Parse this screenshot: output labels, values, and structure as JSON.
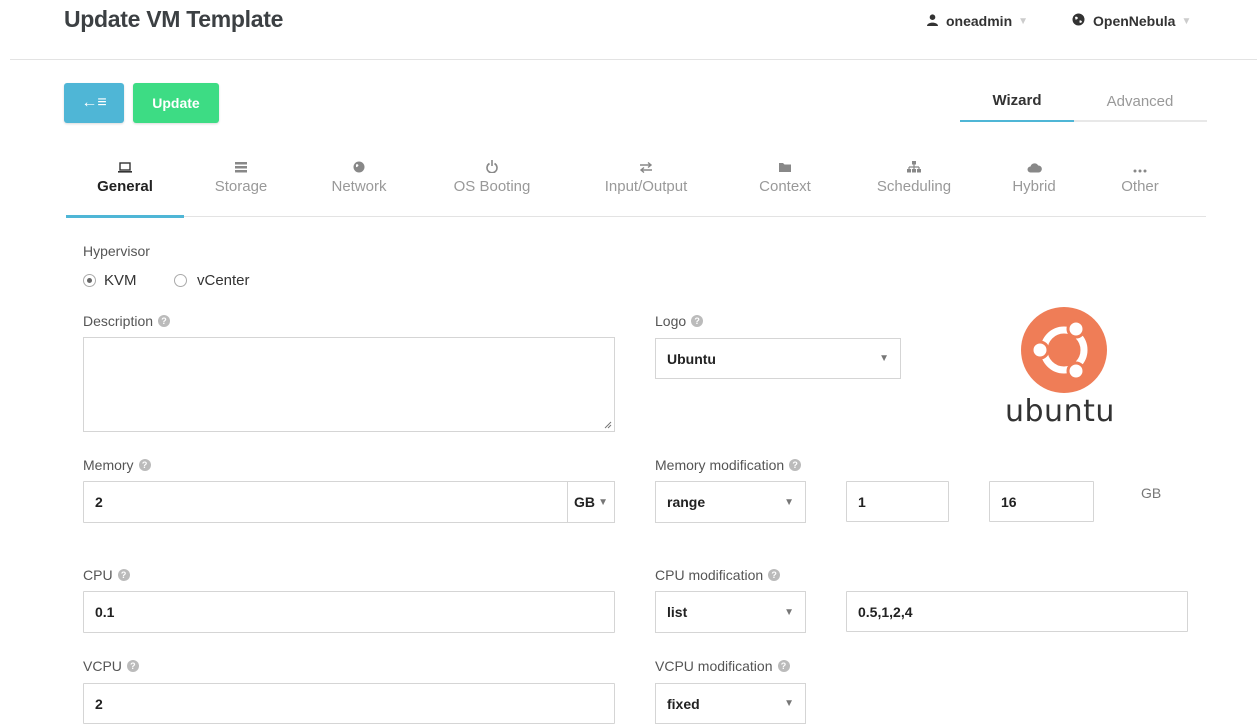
{
  "header": {
    "title": "Update VM Template",
    "user": "oneadmin",
    "zone": "OpenNebula"
  },
  "toolbar": {
    "back_icon": "←≡",
    "update_label": "Update"
  },
  "modes": {
    "wizard": "Wizard",
    "advanced": "Advanced",
    "active": "Wizard"
  },
  "tabs": [
    {
      "label": "General",
      "icon": "laptop-icon",
      "glyph": "▭"
    },
    {
      "label": "Storage",
      "icon": "storage-icon",
      "glyph": "☰"
    },
    {
      "label": "Network",
      "icon": "globe-icon",
      "glyph": "●"
    },
    {
      "label": "OS Booting",
      "icon": "power-icon",
      "glyph": "⏻"
    },
    {
      "label": "Input/Output",
      "icon": "exchange-icon",
      "glyph": "⇄"
    },
    {
      "label": "Context",
      "icon": "folder-icon",
      "glyph": "■"
    },
    {
      "label": "Scheduling",
      "icon": "sitemap-icon",
      "glyph": "☷"
    },
    {
      "label": "Hybrid",
      "icon": "cloud-icon",
      "glyph": "☁"
    },
    {
      "label": "Other",
      "icon": "ellipsis-icon",
      "glyph": "…"
    }
  ],
  "form": {
    "hypervisor": {
      "label": "Hypervisor",
      "options": [
        "KVM",
        "vCenter"
      ],
      "selected": "KVM"
    },
    "description": {
      "label": "Description",
      "value": ""
    },
    "logo": {
      "label": "Logo",
      "value": "Ubuntu",
      "preview_text": "ubuntu"
    },
    "memory": {
      "label": "Memory",
      "value": "2",
      "unit": "GB"
    },
    "memory_modification": {
      "label": "Memory modification",
      "type": "range",
      "min": "1",
      "max": "16",
      "unit": "GB"
    },
    "cpu": {
      "label": "CPU",
      "value": "0.1"
    },
    "cpu_modification": {
      "label": "CPU modification",
      "type": "list",
      "options": "0.5,1,2,4"
    },
    "vcpu": {
      "label": "VCPU",
      "value": "2"
    },
    "vcpu_modification": {
      "label": "VCPU modification",
      "type": "fixed"
    }
  },
  "colors": {
    "primary": "#4fb6d6",
    "success": "#3ddc84",
    "ubuntu_orange": "#ef7d57"
  }
}
